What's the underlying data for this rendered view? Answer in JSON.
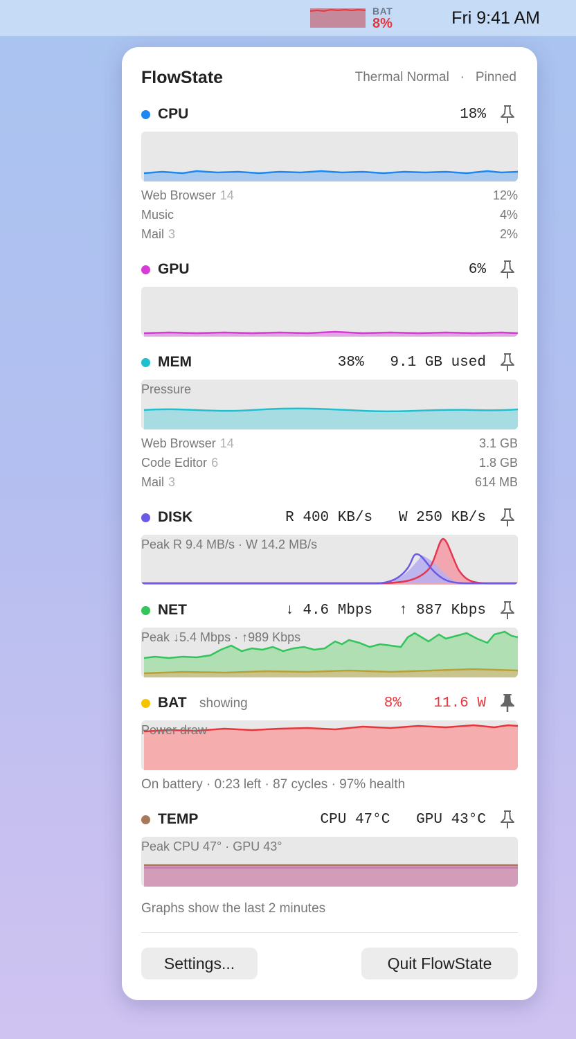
{
  "menubar": {
    "bat_label": "BAT",
    "bat_value": "8%",
    "clock": "Fri 9:41 AM"
  },
  "popover": {
    "title": "FlowState",
    "thermal": "Thermal Normal",
    "separator": "·",
    "pinned": "Pinned",
    "footer_note": "Graphs show the last 2 minutes",
    "settings_label": "Settings...",
    "quit_label": "Quit FlowState"
  },
  "colors": {
    "cpu": "#1e88f0",
    "gpu": "#d63ad8",
    "mem": "#1fbfcf",
    "disk": "#6a5ae8",
    "net": "#33c45b",
    "bat": "#f5c400",
    "temp": "#a8785a",
    "alert": "#e8343b"
  },
  "sections": {
    "cpu": {
      "name": "CPU",
      "metric": "18%",
      "pinned": false,
      "processes": [
        {
          "name": "Web Browser",
          "count": "14",
          "value": "12%"
        },
        {
          "name": "Music",
          "count": "",
          "value": "4%"
        },
        {
          "name": "Mail",
          "count": "3",
          "value": "2%"
        }
      ]
    },
    "gpu": {
      "name": "GPU",
      "metric": "6%",
      "pinned": false
    },
    "mem": {
      "name": "MEM",
      "metric": "38%   9.1 GB used",
      "graph_label": "Pressure",
      "pinned": false,
      "processes": [
        {
          "name": "Web Browser",
          "count": "14",
          "value": "3.1 GB"
        },
        {
          "name": "Code Editor",
          "count": "6",
          "value": "1.8 GB"
        },
        {
          "name": "Mail",
          "count": "3",
          "value": "614 MB"
        }
      ]
    },
    "disk": {
      "name": "DISK",
      "metric": "R 400 KB/s   W 250 KB/s",
      "graph_label": "Peak R 9.4 MB/s · W 14.2 MB/s",
      "pinned": false
    },
    "net": {
      "name": "NET",
      "metric": "↓ 4.6 Mbps   ↑ 887 Kbps",
      "graph_label": "Peak ↓5.4 Mbps · ↑989 Kbps",
      "pinned": false
    },
    "bat": {
      "name": "BAT",
      "status": "showing",
      "metric_pct": "8%",
      "metric_power": "11.6 W",
      "graph_label": "Power draw",
      "info": "On battery · 0:23 left · 87 cycles · 97% health",
      "pinned": true
    },
    "temp": {
      "name": "TEMP",
      "metric": "CPU 47°C   GPU 43°C",
      "graph_label": "Peak CPU 47° · GPU 43°",
      "pinned": false
    }
  }
}
